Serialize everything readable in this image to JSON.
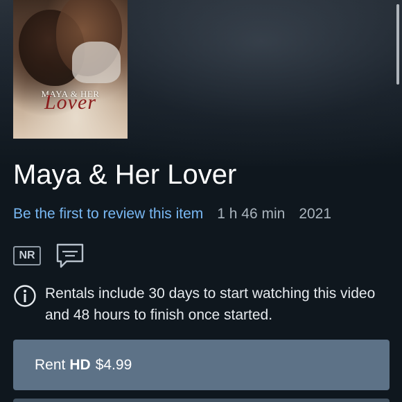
{
  "poster": {
    "title_top": "MAYA & HER",
    "title_script": "Lover"
  },
  "title": "Maya & Her Lover",
  "meta": {
    "review_link": "Be the first to review this item",
    "runtime": "1 h 46 min",
    "year": "2021"
  },
  "badges": {
    "rating": "NR",
    "captions_icon": "closed-captions-icon"
  },
  "info": {
    "icon": "info-icon",
    "text": "Rentals include 30 days to start watching this video and 48 hours to finish once started."
  },
  "rent_button": {
    "label": "Rent",
    "quality": "HD",
    "price": "$4.99"
  },
  "colors": {
    "background": "#0f171e",
    "link": "#79b8f3",
    "button": "#5d7287"
  }
}
